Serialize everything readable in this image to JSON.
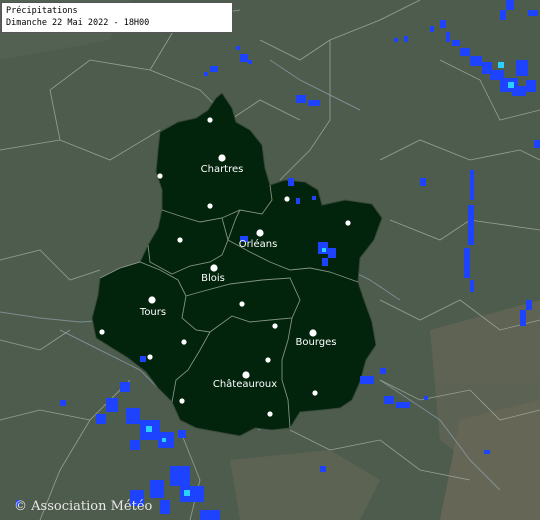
{
  "legend": {
    "title": "Précipitations",
    "date": "Dimanche 22 Mai 2022 - 18H00"
  },
  "cities": [
    {
      "id": "chartres",
      "name": "Chartres"
    },
    {
      "id": "orleans",
      "name": "Orléans"
    },
    {
      "id": "blois",
      "name": "Blois"
    },
    {
      "id": "tours",
      "name": "Tours"
    },
    {
      "id": "bourges",
      "name": "Bourges"
    },
    {
      "id": "chateauroux",
      "name": "Châteauroux"
    }
  ],
  "copyright": "© Association Météo",
  "colors": {
    "region_fill": "#02230c",
    "terrain": "#4d5b4c",
    "precipitation": "#1e43ff",
    "precipitation_heavy": "#2ad0ff",
    "borders": "#b8bfb6"
  }
}
